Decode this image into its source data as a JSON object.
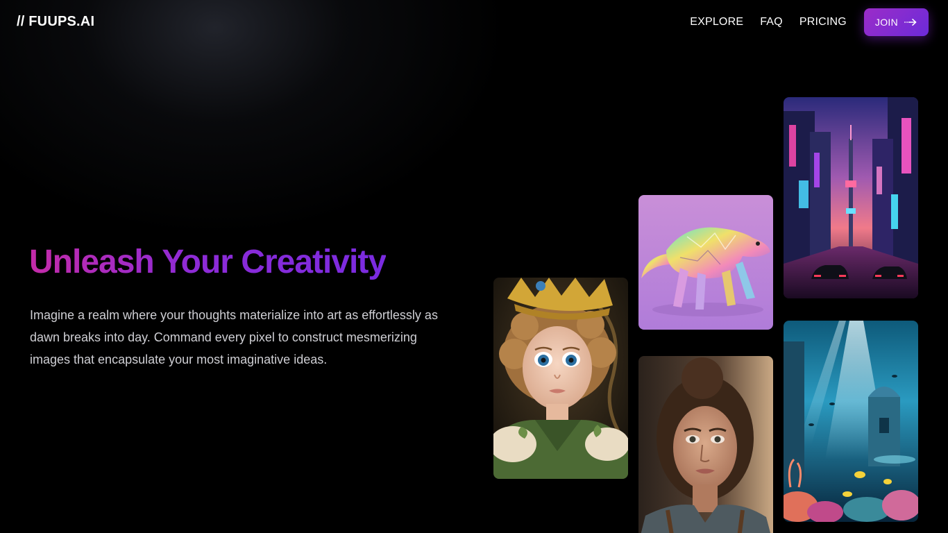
{
  "header": {
    "logo": "// FUUPS.AI",
    "nav": [
      {
        "label": "EXPLORE"
      },
      {
        "label": "FAQ"
      },
      {
        "label": "PRICING"
      }
    ],
    "join_label": "JOIN",
    "join_icon": "arrow-right-icon"
  },
  "hero": {
    "title": "Unleash Your Creativity",
    "description": "Imagine a realm where your thoughts materialize into art as effortlessly as dawn breaks into day. Command every pixel to construct mesmerizing images that encapsulate your most imaginative ideas."
  },
  "gallery": [
    {
      "name": "elf-prince-image"
    },
    {
      "name": "crystal-dinosaur-image"
    },
    {
      "name": "woman-portrait-image"
    },
    {
      "name": "neon-city-image"
    },
    {
      "name": "underwater-ruins-image"
    }
  ],
  "colors": {
    "accent_start": "#c42ba8",
    "accent_end": "#7a2be0",
    "button": "#8a2bd0",
    "background": "#000000"
  }
}
